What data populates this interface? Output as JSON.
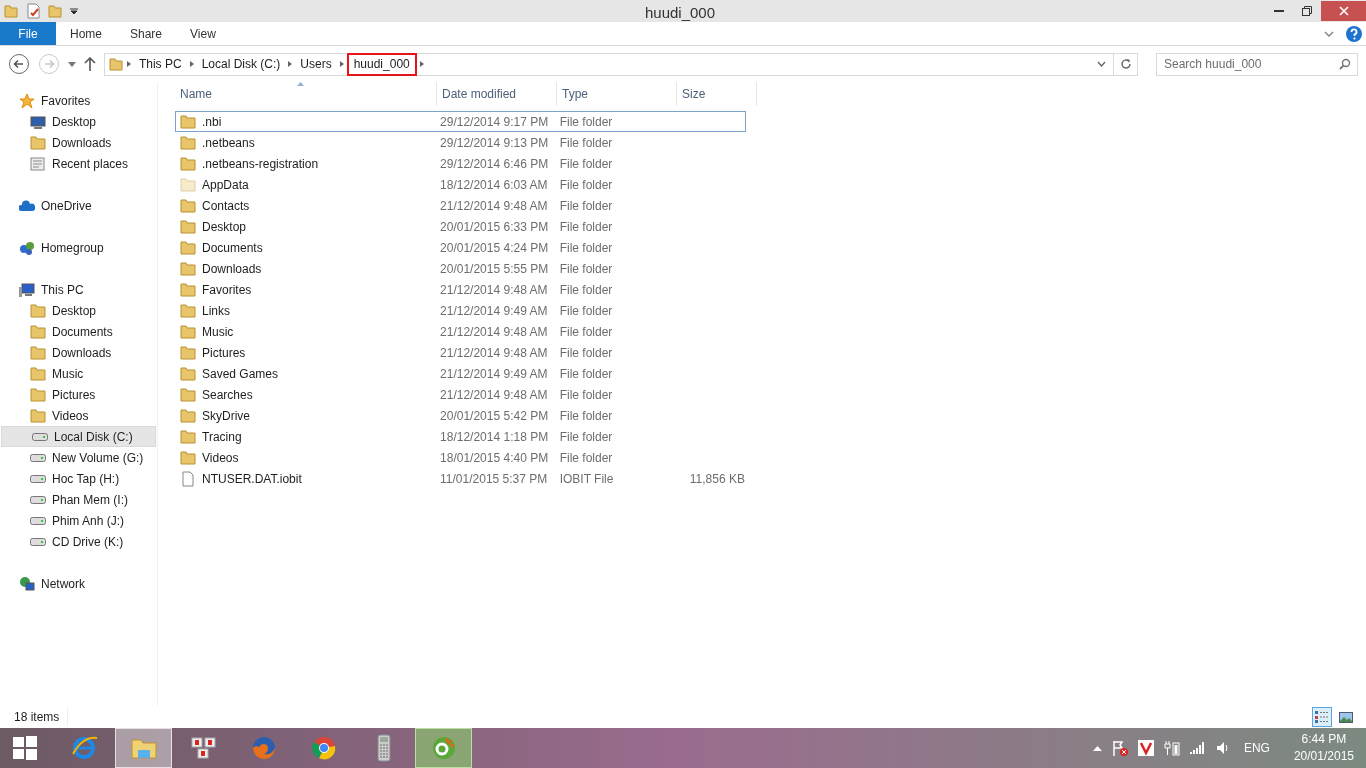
{
  "window": {
    "title": "huudi_000"
  },
  "ribbon": {
    "tabs": [
      {
        "label": "File",
        "kind": "file"
      },
      {
        "label": "Home",
        "kind": "tab"
      },
      {
        "label": "Share",
        "kind": "tab"
      },
      {
        "label": "View",
        "kind": "tab"
      }
    ]
  },
  "address": {
    "crumbs": [
      {
        "label": "This PC",
        "highlighted": false
      },
      {
        "label": "Local Disk (C:)",
        "highlighted": false
      },
      {
        "label": "Users",
        "highlighted": false
      },
      {
        "label": "huudi_000",
        "highlighted": true
      }
    ],
    "search_placeholder": "Search huudi_000"
  },
  "sidebar": {
    "groups": [
      {
        "label": "Favorites",
        "kind": "star",
        "children": [
          {
            "label": "Desktop",
            "kind": "desktop",
            "selected": false
          },
          {
            "label": "Downloads",
            "kind": "folder",
            "selected": false
          },
          {
            "label": "Recent places",
            "kind": "recent",
            "selected": false
          }
        ]
      },
      {
        "label": "OneDrive",
        "kind": "cloud"
      },
      {
        "label": "Homegroup",
        "kind": "homegroup"
      },
      {
        "label": "This PC",
        "kind": "pc",
        "children": [
          {
            "label": "Desktop",
            "kind": "folder",
            "selected": false
          },
          {
            "label": "Documents",
            "kind": "folder",
            "selected": false
          },
          {
            "label": "Downloads",
            "kind": "folder",
            "selected": false
          },
          {
            "label": "Music",
            "kind": "folder",
            "selected": false
          },
          {
            "label": "Pictures",
            "kind": "folder",
            "selected": false
          },
          {
            "label": "Videos",
            "kind": "folder",
            "selected": false
          },
          {
            "label": "Local Disk (C:)",
            "kind": "drive",
            "selected": true
          },
          {
            "label": "New Volume (G:)",
            "kind": "drive",
            "selected": false
          },
          {
            "label": "Hoc Tap (H:)",
            "kind": "drive",
            "selected": false
          },
          {
            "label": "Phan Mem (I:)",
            "kind": "drive",
            "selected": false
          },
          {
            "label": "Phim Anh (J:)",
            "kind": "drive",
            "selected": false
          },
          {
            "label": "CD Drive (K:)",
            "kind": "drive",
            "selected": false
          }
        ]
      },
      {
        "label": "Network",
        "kind": "network"
      }
    ]
  },
  "table": {
    "columns": [
      "Name",
      "Date modified",
      "Type",
      "Size"
    ],
    "rows": [
      {
        "name": ".nbi",
        "date": "29/12/2014 9:17 PM",
        "type": "File folder",
        "kind": "folder",
        "focused": true
      },
      {
        "name": ".netbeans",
        "date": "29/12/2014 9:13 PM",
        "type": "File folder",
        "kind": "folder",
        "focused": false
      },
      {
        "name": ".netbeans-registration",
        "date": "29/12/2014 6:46 PM",
        "type": "File folder",
        "kind": "folder",
        "focused": false
      },
      {
        "name": "AppData",
        "date": "18/12/2014 6:03 AM",
        "type": "File folder",
        "kind": "hidden-folder",
        "focused": false
      },
      {
        "name": "Contacts",
        "date": "21/12/2014 9:48 AM",
        "type": "File folder",
        "kind": "folder",
        "focused": false
      },
      {
        "name": "Desktop",
        "date": "20/01/2015 6:33 PM",
        "type": "File folder",
        "kind": "folder",
        "focused": false
      },
      {
        "name": "Documents",
        "date": "20/01/2015 4:24 PM",
        "type": "File folder",
        "kind": "folder",
        "focused": false
      },
      {
        "name": "Downloads",
        "date": "20/01/2015 5:55 PM",
        "type": "File folder",
        "kind": "folder",
        "focused": false
      },
      {
        "name": "Favorites",
        "date": "21/12/2014 9:48 AM",
        "type": "File folder",
        "kind": "folder",
        "focused": false
      },
      {
        "name": "Links",
        "date": "21/12/2014 9:49 AM",
        "type": "File folder",
        "kind": "folder",
        "focused": false
      },
      {
        "name": "Music",
        "date": "21/12/2014 9:48 AM",
        "type": "File folder",
        "kind": "folder",
        "focused": false
      },
      {
        "name": "Pictures",
        "date": "21/12/2014 9:48 AM",
        "type": "File folder",
        "kind": "folder",
        "focused": false
      },
      {
        "name": "Saved Games",
        "date": "21/12/2014 9:49 AM",
        "type": "File folder",
        "kind": "folder",
        "focused": false
      },
      {
        "name": "Searches",
        "date": "21/12/2014 9:48 AM",
        "type": "File folder",
        "kind": "folder",
        "focused": false
      },
      {
        "name": "SkyDrive",
        "date": "20/01/2015 5:42 PM",
        "type": "File folder",
        "kind": "folder",
        "focused": false
      },
      {
        "name": "Tracing",
        "date": "18/12/2014 1:18 PM",
        "type": "File folder",
        "kind": "folder",
        "focused": false
      },
      {
        "name": "Videos",
        "date": "18/01/2015 4:40 PM",
        "type": "File folder",
        "kind": "folder",
        "focused": false
      },
      {
        "name": "NTUSER.DAT.iobit",
        "date": "11/01/2015 5:37 PM",
        "type": "IOBIT File",
        "size": "11,856 KB",
        "kind": "file",
        "focused": false
      }
    ]
  },
  "status_bar": {
    "count": "18 items",
    "details_view": true
  },
  "taskbar": {
    "apps": [
      {
        "kind": "globe-e",
        "active": false
      },
      {
        "kind": "folder",
        "active": true
      },
      {
        "kind": "keys",
        "active": false
      },
      {
        "kind": "fox",
        "active": false
      },
      {
        "kind": "wheel",
        "active": false
      },
      {
        "kind": "calculator",
        "active": false
      },
      {
        "kind": "green-app",
        "active": true
      }
    ],
    "language": "ENG",
    "time": "6:44 PM",
    "date": "20/01/2015"
  }
}
